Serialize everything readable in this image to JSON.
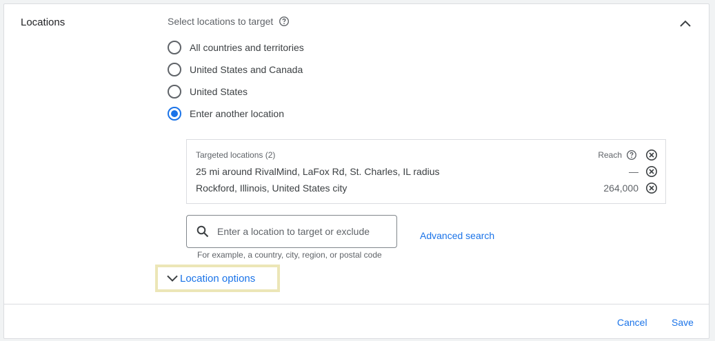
{
  "section": {
    "title": "Locations",
    "subtitle": "Select locations to target"
  },
  "options": [
    {
      "label": "All countries and territories",
      "checked": false
    },
    {
      "label": "United States and Canada",
      "checked": false
    },
    {
      "label": "United States",
      "checked": false
    },
    {
      "label": "Enter another location",
      "checked": true
    }
  ],
  "targeted": {
    "header": "Targeted locations (2)",
    "reach_label": "Reach",
    "rows": [
      {
        "name": "25 mi around RivalMind, LaFox Rd, St. Charles, IL radius",
        "reach": "—"
      },
      {
        "name": "Rockford, Illinois, United States city",
        "reach": "264,000"
      }
    ]
  },
  "search": {
    "placeholder": "Enter a location to target or exclude",
    "hint": "For example, a country, city, region, or postal code",
    "advanced_label": "Advanced search"
  },
  "location_options_label": "Location options",
  "footer": {
    "cancel_label": "Cancel",
    "save_label": "Save"
  },
  "colors": {
    "accent": "#1a73e8",
    "highlight_border": "#ece6b7"
  },
  "icons": [
    "help-icon",
    "chevron-up-icon",
    "remove-icon",
    "search-icon",
    "chevron-down-icon"
  ]
}
